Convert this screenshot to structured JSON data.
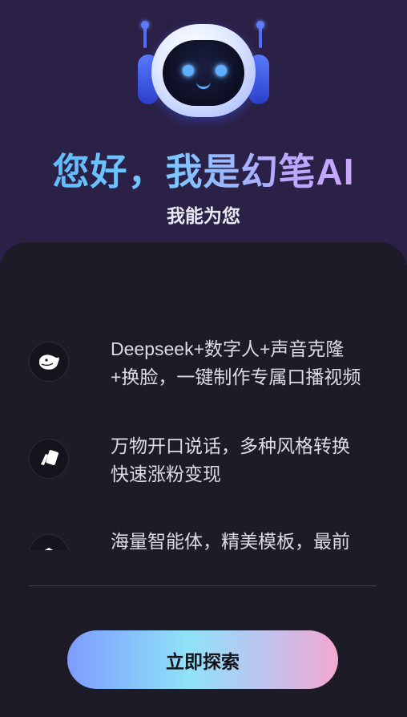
{
  "header": {
    "greeting": "您好，我是幻笔AI",
    "subtitle": "我能为您"
  },
  "features": [
    {
      "icon": "whale-icon",
      "line1": "Deepseek+数字人+声音克隆",
      "line2": "+换脸，一键制作专属口播视频"
    },
    {
      "icon": "cards-icon",
      "line1": "万物开口说话，多种风格转换",
      "line2": "快速涨粉变现"
    },
    {
      "icon": "agent-icon",
      "line1": "海量智能体，精美模板，最前",
      "line2": ""
    }
  ],
  "cta": {
    "label": "立即探索"
  },
  "colors": {
    "accent_blue": "#4fb6ff",
    "accent_pink": "#f3a8cf",
    "background": "#1d1b27"
  }
}
